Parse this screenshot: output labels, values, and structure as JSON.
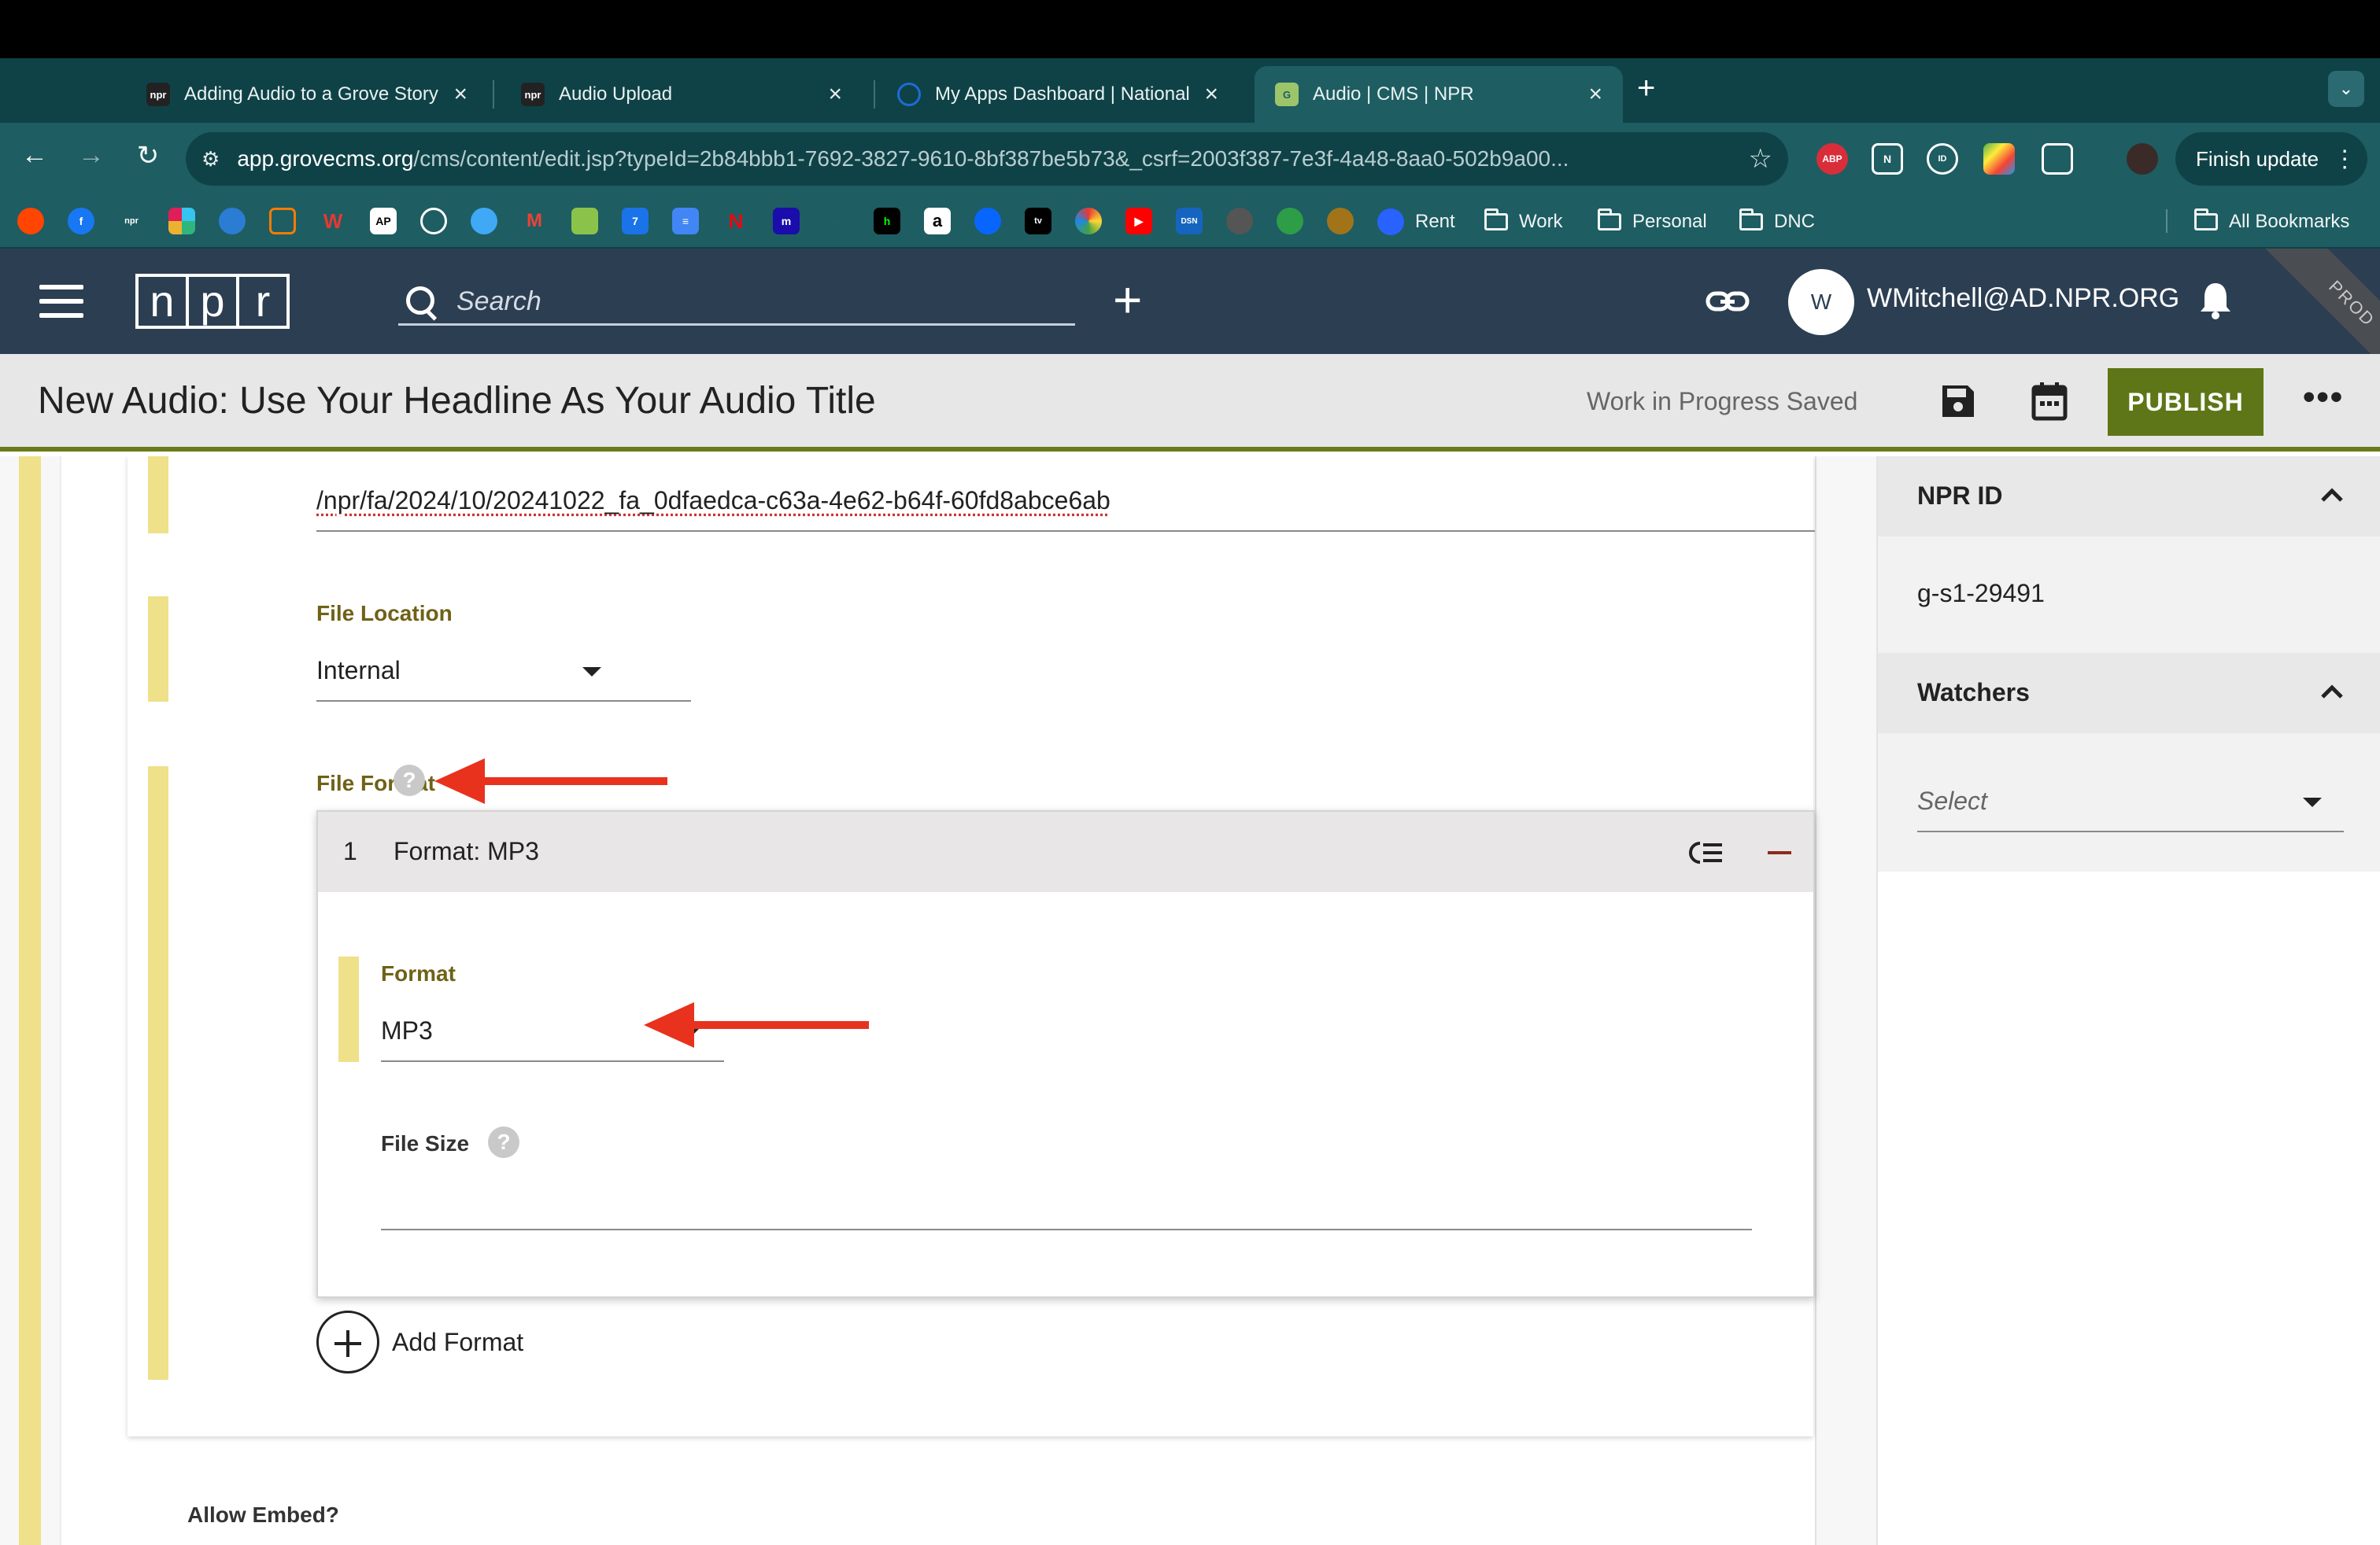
{
  "browser": {
    "tabs": [
      {
        "title": "Adding Audio to a Grove Story",
        "favicon": "npr"
      },
      {
        "title": "Audio Upload",
        "favicon": "npr"
      },
      {
        "title": "My Apps Dashboard | National",
        "favicon": "okta"
      },
      {
        "title": "Audio | CMS | NPR",
        "favicon": "grove"
      }
    ],
    "url_host": "app.grovecms.org",
    "url_path": "/cms/content/edit.jsp?typeId=2b84bbb1-7692-3827-9610-8bf387be5b73&_csrf=2003f387-7e3f-4a48-8aa0-502b9a00...",
    "finish_update": "Finish update",
    "bookmarks": {
      "rent": "Rent",
      "work": "Work",
      "personal": "Personal",
      "dnc": "DNC",
      "all": "All Bookmarks"
    }
  },
  "app": {
    "logo_letters": [
      "n",
      "p",
      "r"
    ],
    "search_placeholder": "Search",
    "avatar_initial": "W",
    "username": "WMitchell@AD.NPR.ORG",
    "env_badge": "PROD"
  },
  "titlebar": {
    "title": "New Audio: Use Your Headline As Your Audio Title",
    "status": "Work in Progress Saved",
    "publish": "PUBLISH"
  },
  "form": {
    "file_path": "/npr/fa/2024/10/20241022_fa_0dfaedca-c63a-4e62-b64f-60fd8abce6ab",
    "file_location_label": "File Location",
    "file_location_value": "Internal",
    "file_format_label": "File Format",
    "format_item_number": "1",
    "format_item_title": "Format: MP3",
    "format_label": "Format",
    "format_value": "MP3",
    "file_size_label": "File Size",
    "add_format": "Add Format",
    "allow_embed": "Allow Embed?"
  },
  "sidebar": {
    "npr_id_label": "NPR ID",
    "npr_id_value": "g-s1-29491",
    "watchers_label": "Watchers",
    "watchers_placeholder": "Select"
  },
  "colors": {
    "tab_bar": "#0f4247",
    "app_bar": "#2c3e52",
    "publish": "#5e7617",
    "field_label": "#6f6217",
    "annotation_arrow": "#e8321e"
  }
}
